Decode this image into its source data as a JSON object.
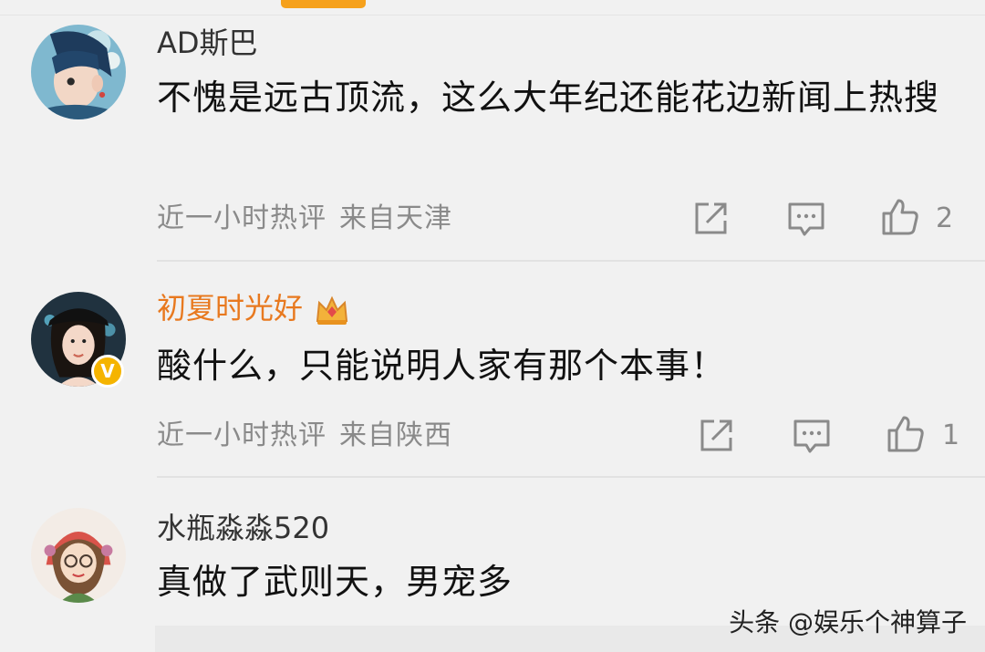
{
  "comments": [
    {
      "username": "AD斯巴",
      "content": "不愧是远古顶流，这么大年纪还能花边新闻上热搜",
      "time": "近一小时热评",
      "location": "来自天津",
      "likes": "2",
      "avatar_icon": "anime-boy-avatar"
    },
    {
      "username": "初夏时光好",
      "content": "酸什么，只能说明人家有那个本事！",
      "time": "近一小时热评",
      "location": "来自陕西",
      "likes": "1",
      "verified_mark": "V",
      "avatar_icon": "girl-photo-avatar",
      "badge_icon": "crown-icon"
    },
    {
      "username": "水瓶淼淼520",
      "content": "真做了武则天，男宠多",
      "avatar_icon": "cartoon-girl-avatar"
    }
  ],
  "watermark": "头条 @娱乐个神算子",
  "colors": {
    "accent": "#f6a11c",
    "vip_name": "#e8791f",
    "meta": "#8a8a8a",
    "background": "#f1f1f1"
  }
}
